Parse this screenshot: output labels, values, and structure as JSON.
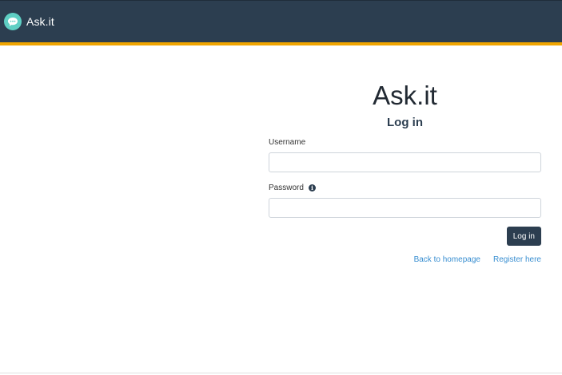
{
  "navbar": {
    "brand_name": "Ask.it",
    "brand_logo_icon": "chat-bubble-icon",
    "background_color": "#2c3e50",
    "accent_color": "#f0a500"
  },
  "login": {
    "app_title": "Ask.it",
    "heading": "Log in",
    "username_label": "Username",
    "username_value": "",
    "password_label": "Password",
    "password_value": "",
    "password_info_icon": "info-circle-icon",
    "submit_label": "Log in",
    "back_link": "Back to homepage",
    "register_link": "Register here",
    "link_color": "#3a8fd1"
  }
}
